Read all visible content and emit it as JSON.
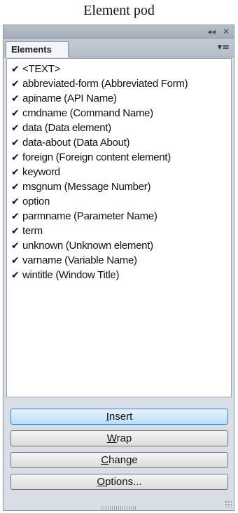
{
  "caption": "Element pod",
  "titlebar": {
    "collapse_glyph": "◂◂",
    "close_glyph": "✕"
  },
  "tab": {
    "label": "Elements"
  },
  "menu_glyph": "▾≡",
  "check_glyph": "✔",
  "elements": [
    "<TEXT>",
    "abbreviated-form  (Abbreviated Form)",
    "apiname  (API Name)",
    "cmdname  (Command Name)",
    "data  (Data element)",
    "data-about  (Data About)",
    "foreign  (Foreign content element)",
    "keyword",
    "msgnum  (Message Number)",
    "option",
    "parmname  (Parameter Name)",
    "term",
    "unknown  (Unknown element)",
    "varname  (Variable Name)",
    "wintitle  (Window Title)"
  ],
  "buttons": {
    "insert": {
      "mnemonic": "I",
      "rest": "nsert"
    },
    "wrap": {
      "mnemonic": "W",
      "rest": "rap"
    },
    "change": {
      "mnemonic": "C",
      "rest": "hange"
    },
    "options": {
      "mnemonic": "O",
      "rest": "ptions..."
    }
  }
}
